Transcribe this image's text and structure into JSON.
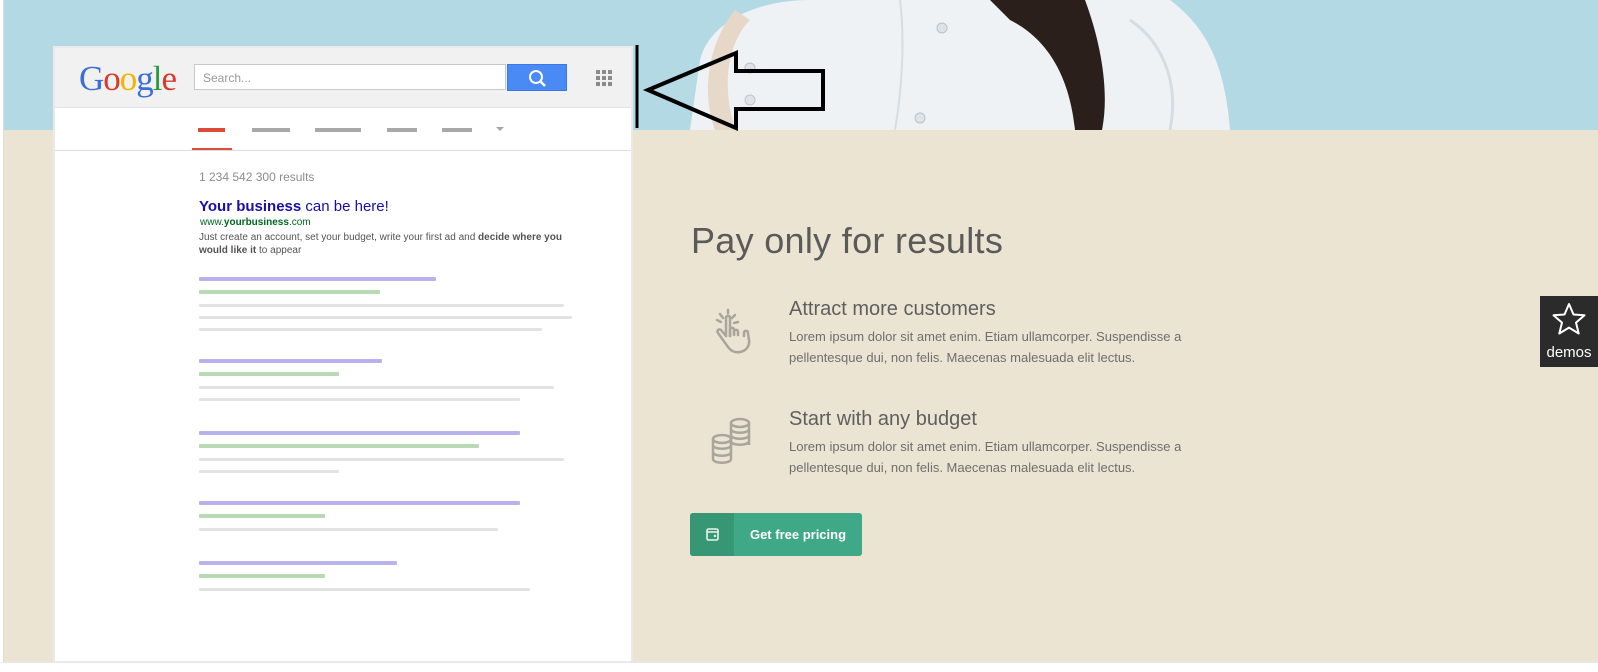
{
  "google_mockup": {
    "logo_letters": [
      {
        "ch": "G",
        "color": "#3b6fd6"
      },
      {
        "ch": "o",
        "color": "#d93a2b"
      },
      {
        "ch": "o",
        "color": "#f2b400"
      },
      {
        "ch": "g",
        "color": "#3b6fd6"
      },
      {
        "ch": "l",
        "color": "#2c9a3f"
      },
      {
        "ch": "e",
        "color": "#d93a2b"
      }
    ],
    "search_placeholder": "Search...",
    "results_count": "1 234 542 300 results",
    "ad": {
      "title_bold": "Your business",
      "title_rest": " can be here!",
      "url_prefix": "www.",
      "url_bold": "yourbusiness",
      "url_suffix": ".com",
      "desc_start": "Just create an account, set your budget, write your first ad and ",
      "desc_bold": "decide where you would like it",
      "desc_end": " to appear"
    }
  },
  "main": {
    "heading": "Pay only for results",
    "features": [
      {
        "title": "Attract more customers",
        "text": "Lorem ipsum dolor sit amet enim. Etiam ullamcorper. Suspendisse a pellentesque dui, non felis. Maecenas malesuada elit lectus.",
        "icon": "hand-tap-icon"
      },
      {
        "title": "Start with any budget",
        "text": "Lorem ipsum dolor sit amet enim. Etiam ullamcorper. Suspendisse a pellentesque dui, non felis. Maecenas malesuada elit lectus.",
        "icon": "coins-icon"
      }
    ],
    "cta_label": "Get free pricing"
  },
  "demos_label": "demos",
  "colors": {
    "accent_green": "#3fa886",
    "content_bg": "#ebe4d3",
    "hero_bg": "#b3dae4"
  }
}
